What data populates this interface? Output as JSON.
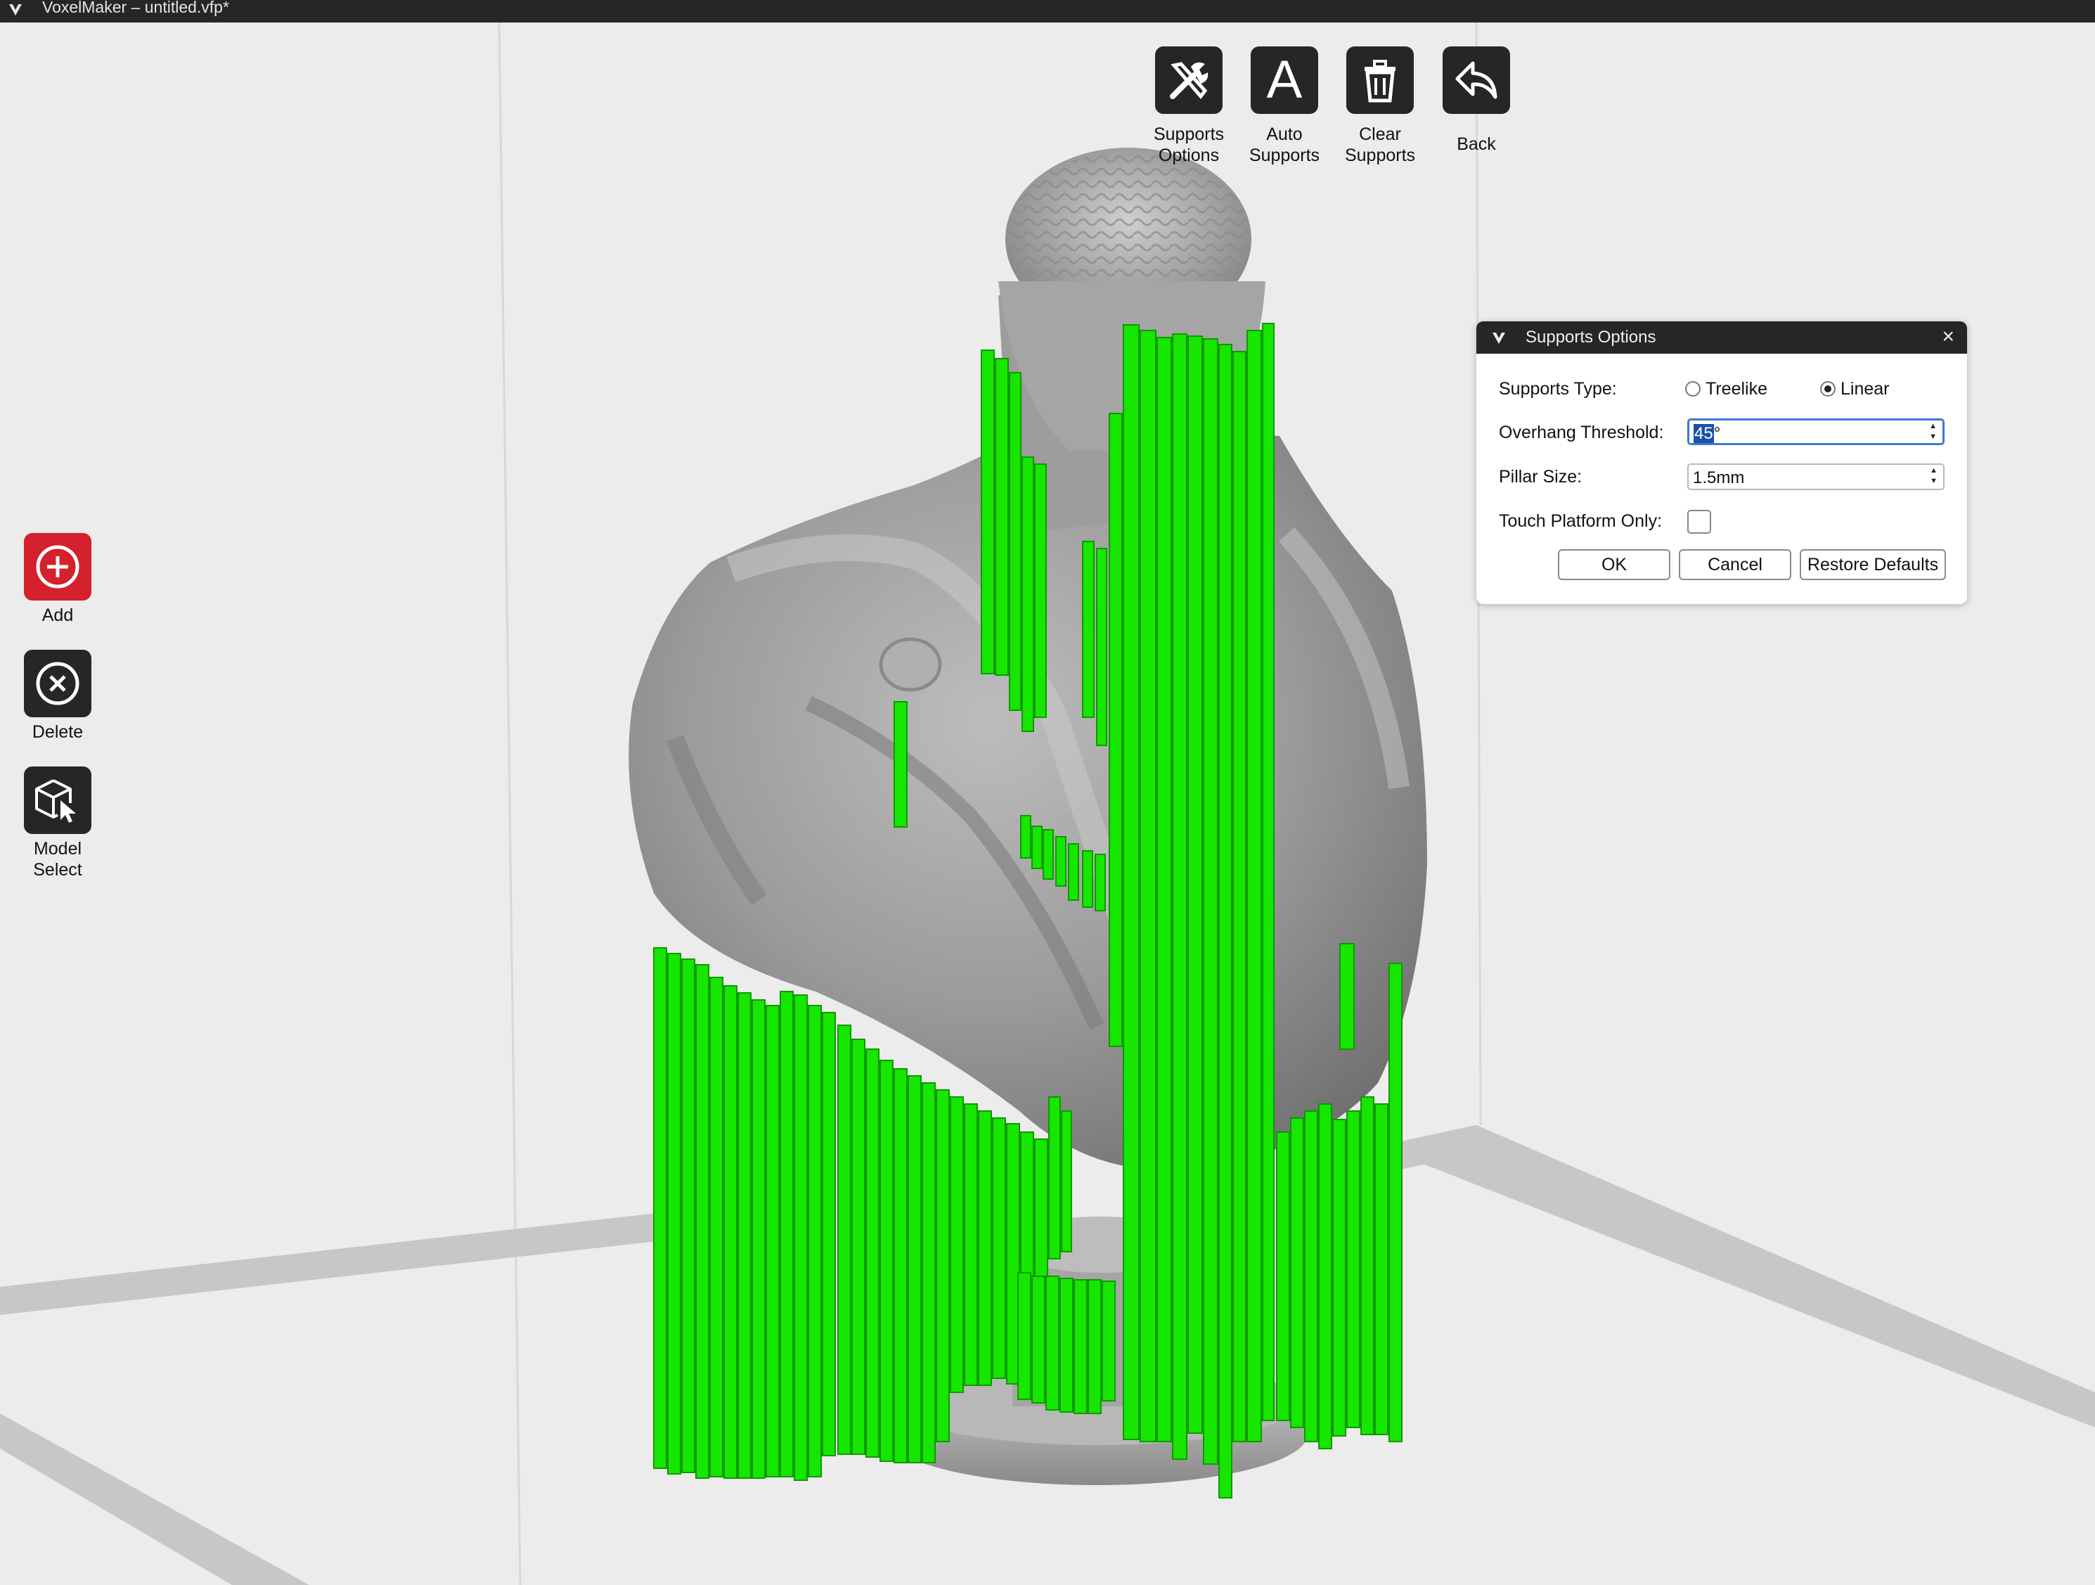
{
  "window": {
    "title": "VoxelMaker – untitled.vfp*"
  },
  "toolbar": {
    "supports_options": "Supports\nOptions",
    "auto_supports": "Auto\nSupports",
    "clear_supports": "Clear\nSupports",
    "back": "Back"
  },
  "sidebar": {
    "add": "Add",
    "delete": "Delete",
    "model_select": "Model\nSelect"
  },
  "dialog": {
    "title": "Supports Options",
    "supports_type_label": "Supports Type:",
    "treelike_label": "Treelike",
    "linear_label": "Linear",
    "selected_type": "Linear",
    "overhang_label": "Overhang Threshold:",
    "overhang_number": "45",
    "overhang_unit": "°",
    "pillar_label": "Pillar Size:",
    "pillar_value": "1.5mm",
    "touch_label": "Touch Platform Only:",
    "touch_checked": false,
    "ok": "OK",
    "cancel": "Cancel",
    "restore": "Restore Defaults"
  },
  "colors": {
    "support_green": "#16e600",
    "model_gray": "#8e8e8e",
    "accent_red": "#d5202d",
    "dark": "#262626"
  }
}
